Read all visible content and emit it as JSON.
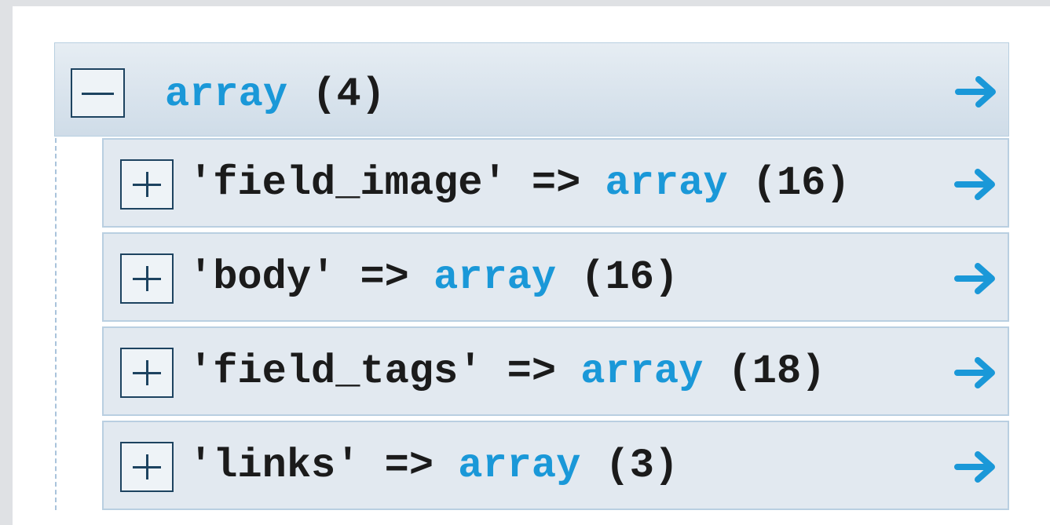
{
  "root": {
    "type_label": "array",
    "count_label": " (4)",
    "toggle_icon": "collapse-minus-icon",
    "arrow_icon": "arrow-right-icon"
  },
  "children": [
    {
      "key": "'field_image'",
      "operator": " => ",
      "type_label": "array",
      "count_label": " (16)",
      "toggle_icon": "expand-plus-icon"
    },
    {
      "key": "'body'",
      "operator": " => ",
      "type_label": "array",
      "count_label": " (16)",
      "toggle_icon": "expand-plus-icon"
    },
    {
      "key": "'field_tags'",
      "operator": " => ",
      "type_label": "array",
      "count_label": " (18)",
      "toggle_icon": "expand-plus-icon"
    },
    {
      "key": "'links'",
      "operator": " => ",
      "type_label": "array",
      "count_label": " (3)",
      "toggle_icon": "expand-plus-icon"
    }
  ],
  "colors": {
    "keyword": "#1a98d8",
    "text": "#1b1b1b",
    "toggle_border": "#1d4360",
    "arrow": "#1a98d8",
    "row_border": "#b9cfe1",
    "row_bg": "#e2e9f0"
  }
}
